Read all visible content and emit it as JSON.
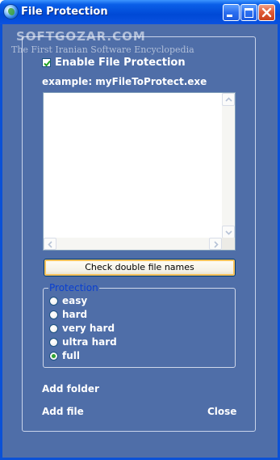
{
  "window": {
    "title": "File Protection"
  },
  "watermark": {
    "brand": "SOFTGOZAR.COM",
    "tagline": "The First Iranian Software Encyclopedia"
  },
  "enable_protection": {
    "label": "Enable File Protection",
    "checked": true
  },
  "example_text": "example: myFileToProtect.exe",
  "file_list": {
    "value": ""
  },
  "check_button": {
    "label": "Check double file names"
  },
  "protection": {
    "title": "Protection",
    "options": [
      {
        "label": "easy",
        "selected": false
      },
      {
        "label": "hard",
        "selected": false
      },
      {
        "label": "very hard",
        "selected": false
      },
      {
        "label": "ultra hard",
        "selected": false
      },
      {
        "label": "full",
        "selected": true
      }
    ]
  },
  "actions": {
    "add_folder": "Add folder",
    "add_file": "Add file",
    "close": "Close"
  },
  "colors": {
    "titlebar": "#0a52e0",
    "client_bg": "#4f6ea8",
    "group_title": "#0a3fd0"
  }
}
